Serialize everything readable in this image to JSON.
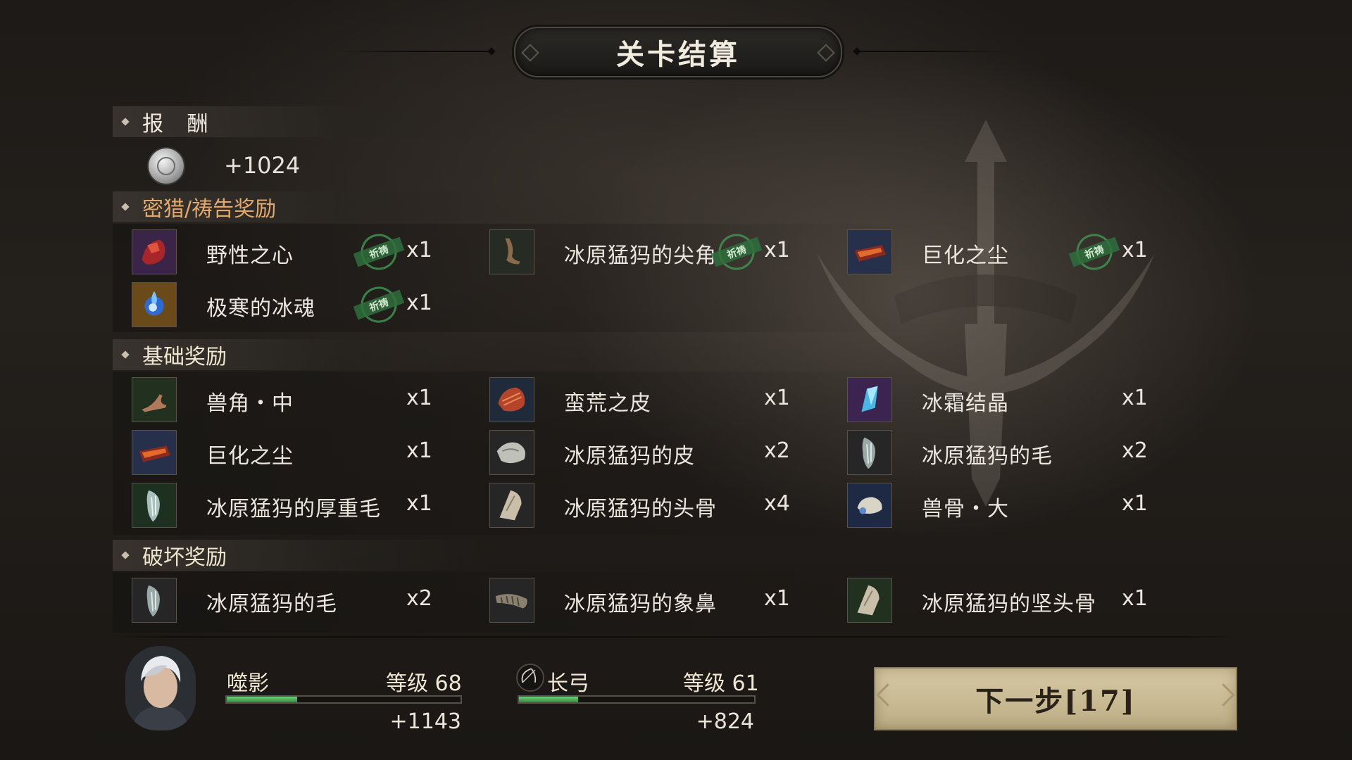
{
  "header": {
    "title": "关卡结算"
  },
  "sections": {
    "reward": {
      "label": "报 酬"
    },
    "hunt": {
      "label": "密猎/祷告奖励"
    },
    "basic": {
      "label": "基础奖励"
    },
    "break": {
      "label": "破坏奖励"
    }
  },
  "currency": {
    "icon": "silver-coin-icon",
    "amount": "+1024"
  },
  "stamp_text": "祈祷",
  "hunt_items": [
    {
      "name": "野性之心",
      "qty": "x1",
      "stamp": true,
      "icon": "wild-heart-icon"
    },
    {
      "name": "冰原猛犸的尖角",
      "qty": "x1",
      "stamp": true,
      "icon": "mammoth-tusk-icon"
    },
    {
      "name": "巨化之尘",
      "qty": "x1",
      "stamp": true,
      "icon": "giant-dust-icon"
    },
    {
      "name": "极寒的冰魂",
      "qty": "x1",
      "stamp": true,
      "icon": "ice-soul-icon"
    }
  ],
  "basic_items": [
    {
      "name": "兽角・中",
      "qty": "x1",
      "icon": "beast-horn-icon"
    },
    {
      "name": "蛮荒之皮",
      "qty": "x1",
      "icon": "wild-hide-icon"
    },
    {
      "name": "冰霜结晶",
      "qty": "x1",
      "icon": "frost-crystal-icon"
    },
    {
      "name": "巨化之尘",
      "qty": "x1",
      "icon": "giant-dust-icon"
    },
    {
      "name": "冰原猛犸的皮",
      "qty": "x2",
      "icon": "mammoth-hide-icon"
    },
    {
      "name": "冰原猛犸的毛",
      "qty": "x2",
      "icon": "mammoth-fur-icon"
    },
    {
      "name": "冰原猛犸的厚重毛",
      "qty": "x1",
      "icon": "mammoth-thick-fur-icon"
    },
    {
      "name": "冰原猛犸的头骨",
      "qty": "x4",
      "icon": "mammoth-skull-icon"
    },
    {
      "name": "兽骨・大",
      "qty": "x1",
      "icon": "large-bone-icon"
    }
  ],
  "break_items": [
    {
      "name": "冰原猛犸的毛",
      "qty": "x2",
      "icon": "mammoth-fur-icon"
    },
    {
      "name": "冰原猛犸的象鼻",
      "qty": "x1",
      "icon": "mammoth-trunk-icon"
    },
    {
      "name": "冰原猛犸的坚头骨",
      "qty": "x1",
      "icon": "mammoth-hard-skull-icon"
    }
  ],
  "player": {
    "name": "噬影",
    "level": "等级 68",
    "xp_gain": "+1143",
    "xp_progress": 0.3
  },
  "weapon": {
    "name": "长弓",
    "level": "等级 61",
    "xp_gain": "+824",
    "xp_progress": 0.25,
    "icon": "longbow-icon"
  },
  "next_button": {
    "label": "下一步[17]"
  },
  "colors": {
    "section_gold": "#e4a96a",
    "xp_green": "#4cb25c",
    "button_bg": "#cbbd95",
    "stamp_green": "#3f9a52"
  }
}
